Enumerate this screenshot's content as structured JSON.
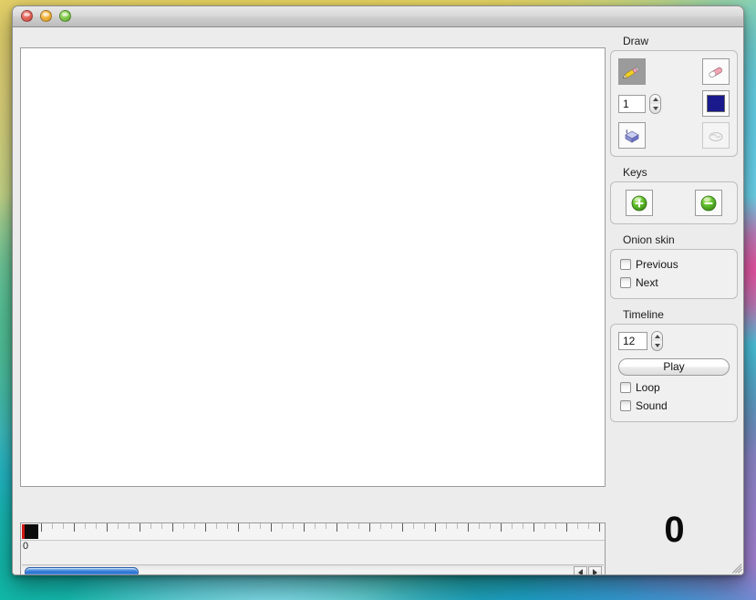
{
  "window": {
    "title": "",
    "controls": [
      {
        "name": "close",
        "label": ""
      },
      {
        "name": "minimize",
        "label": ""
      },
      {
        "name": "zoom",
        "label": ""
      }
    ]
  },
  "panels": {
    "draw": {
      "label": "Draw",
      "tools": [
        {
          "name": "pencil-tool",
          "icon": "pencil-icon",
          "selected": true,
          "disabled": false
        },
        {
          "name": "eraser-tool",
          "icon": "eraser-icon",
          "selected": false,
          "disabled": false
        },
        {
          "name": "fill-tool",
          "icon": "paint-bucket-icon",
          "selected": false,
          "disabled": false
        },
        {
          "name": "smudge-tool",
          "icon": "smudge-icon",
          "selected": false,
          "disabled": true
        }
      ],
      "line_width": "1",
      "color": "#1a1a8c"
    },
    "keys": {
      "label": "Keys",
      "add_label": "+",
      "remove_label": "-"
    },
    "onion_skin": {
      "label": "Onion skin",
      "previous_label": "Previous",
      "previous_checked": false,
      "next_label": "Next",
      "next_checked": false
    },
    "timeline": {
      "label": "Timeline",
      "fps": "12",
      "play_label": "Play",
      "loop_label": "Loop",
      "loop_checked": false,
      "sound_label": "Sound",
      "sound_checked": false
    }
  },
  "frame_counter": "0",
  "ruler": {
    "start_label": "0",
    "current_frame": 0,
    "tick_count": 52,
    "tick_spacing": 12,
    "major_every": 3
  },
  "scrollbar": {
    "thumb_position": 0,
    "thumb_width": 125,
    "left_arrow": "◀",
    "right_arrow": "▶"
  },
  "colors": {
    "accent": "#2a6fd2",
    "swatch": "#1a1a8c",
    "marker": "#0c0c0c",
    "marker_edge": "#d01a14",
    "window_bg": "#ececec",
    "canvas_bg": "#ffffff"
  }
}
